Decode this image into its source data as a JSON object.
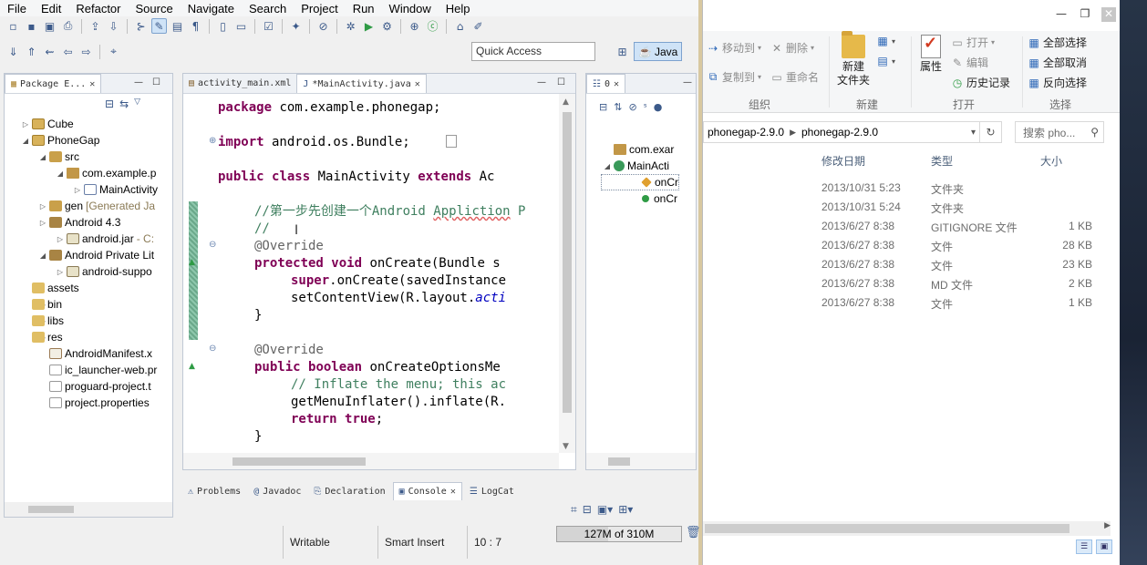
{
  "eclipse": {
    "menu": [
      "File",
      "Edit",
      "Refactor",
      "Source",
      "Navigate",
      "Search",
      "Project",
      "Run",
      "Window",
      "Help"
    ],
    "quick_access": "Quick Access",
    "perspective": "Java",
    "package_explorer": {
      "tab": "Package E...",
      "tree": [
        {
          "label": "Cube",
          "level": 0,
          "twisty": "▷",
          "icon": "proj"
        },
        {
          "label": "PhoneGap",
          "level": 0,
          "twisty": "◢",
          "icon": "proj"
        },
        {
          "label": "src",
          "level": 1,
          "twisty": "◢",
          "icon": "pkgf"
        },
        {
          "label": "com.example.p",
          "level": 2,
          "twisty": "◢",
          "icon": "pkg"
        },
        {
          "label": "MainActivity",
          "level": 3,
          "twisty": "▷",
          "icon": "java"
        },
        {
          "label": "gen",
          "level": 1,
          "twisty": "▷",
          "icon": "pkgf",
          "extra": "[Generated Ja"
        },
        {
          "label": "Android 4.3",
          "level": 1,
          "twisty": "▷",
          "icon": "lib"
        },
        {
          "label": "android.jar",
          "level": 2,
          "twisty": "▷",
          "icon": "jar",
          "extra": "- C:"
        },
        {
          "label": "Android Private Lit",
          "level": 1,
          "twisty": "◢",
          "icon": "lib"
        },
        {
          "label": "android-suppo",
          "level": 2,
          "twisty": "▷",
          "icon": "jar"
        },
        {
          "label": "assets",
          "level": 1,
          "twisty": "",
          "icon": "fold"
        },
        {
          "label": "bin",
          "level": 1,
          "twisty": "▷",
          "icon": "fold"
        },
        {
          "label": "libs",
          "level": 1,
          "twisty": "▷",
          "icon": "fold"
        },
        {
          "label": "res",
          "level": 1,
          "twisty": "▷",
          "icon": "fold"
        },
        {
          "label": "AndroidManifest.x",
          "level": 1,
          "twisty": "",
          "icon": "xml"
        },
        {
          "label": "ic_launcher-web.pr",
          "level": 1,
          "twisty": "",
          "icon": "file"
        },
        {
          "label": "proguard-project.t",
          "level": 1,
          "twisty": "",
          "icon": "file"
        },
        {
          "label": "project.properties",
          "level": 1,
          "twisty": "",
          "icon": "file"
        }
      ]
    },
    "editor": {
      "tabs": [
        {
          "label": "activity_main.xml",
          "active": false
        },
        {
          "label": "*MainActivity.java",
          "active": true
        }
      ],
      "lines": [
        {
          "y": 1,
          "indent": 1,
          "parts": [
            [
              "kw",
              "package"
            ],
            [
              "",
              " com.example.phonegap;"
            ]
          ]
        },
        {
          "y": 3,
          "indent": 1,
          "parts": [
            [
              "kw",
              "import"
            ],
            [
              "",
              " android.os.Bundle;"
            ]
          ]
        },
        {
          "y": 5,
          "indent": 1,
          "parts": [
            [
              "kw",
              "public"
            ],
            [
              "",
              " "
            ],
            [
              "kw",
              "class"
            ],
            [
              "",
              " MainActivity "
            ],
            [
              "kw",
              "extends"
            ],
            [
              "",
              " Ac"
            ]
          ]
        },
        {
          "y": 7,
          "indent": 2,
          "parts": [
            [
              "cm",
              "//第一步先创建一个Android "
            ],
            [
              "cm sq",
              "Appliction"
            ],
            [
              "cm",
              " P"
            ]
          ]
        },
        {
          "y": 8,
          "indent": 2,
          "parts": [
            [
              "cm",
              "//"
            ]
          ]
        },
        {
          "y": 9,
          "indent": 2,
          "parts": [
            [
              "an",
              "@Override"
            ]
          ]
        },
        {
          "y": 10,
          "indent": 2,
          "parts": [
            [
              "kw",
              "protected"
            ],
            [
              "",
              " "
            ],
            [
              "kw",
              "void"
            ],
            [
              "",
              " onCreate(Bundle s"
            ]
          ]
        },
        {
          "y": 11,
          "indent": 3,
          "parts": [
            [
              "kw",
              "super"
            ],
            [
              "",
              ".onCreate(savedInstance"
            ]
          ]
        },
        {
          "y": 12,
          "indent": 3,
          "parts": [
            [
              "",
              "setContentView(R.layout."
            ],
            [
              "it",
              "acti"
            ]
          ]
        },
        {
          "y": 13,
          "indent": 2,
          "parts": [
            [
              "",
              "}"
            ]
          ]
        },
        {
          "y": 15,
          "indent": 2,
          "parts": [
            [
              "an",
              "@Override"
            ]
          ]
        },
        {
          "y": 16,
          "indent": 2,
          "parts": [
            [
              "kw",
              "public"
            ],
            [
              "",
              " "
            ],
            [
              "kw",
              "boolean"
            ],
            [
              "",
              " onCreateOptionsMe"
            ]
          ]
        },
        {
          "y": 17,
          "indent": 3,
          "parts": [
            [
              "cm",
              "// Inflate the menu; this ac"
            ]
          ]
        },
        {
          "y": 18,
          "indent": 3,
          "parts": [
            [
              "",
              "getMenuInflater().inflate(R."
            ]
          ]
        },
        {
          "y": 19,
          "indent": 3,
          "parts": [
            [
              "kw",
              "return"
            ],
            [
              "",
              " "
            ],
            [
              "kw",
              "true"
            ],
            [
              "",
              ";"
            ]
          ]
        },
        {
          "y": 20,
          "indent": 2,
          "parts": [
            [
              "",
              "}"
            ]
          ]
        }
      ]
    },
    "outline": {
      "tab": "0",
      "items": [
        {
          "label": "com.exar",
          "icon": "imp",
          "twisty": ""
        },
        {
          "label": "MainActi",
          "icon": "cls",
          "twisty": "◢"
        },
        {
          "label": "onCr",
          "icon": "mth",
          "twisty": "",
          "sub": true,
          "selected": true
        },
        {
          "label": "onCr",
          "icon": "mth2",
          "twisty": "",
          "sub": true
        }
      ]
    },
    "bottom_tabs": [
      {
        "label": "Problems",
        "active": false
      },
      {
        "label": "Javadoc",
        "active": false
      },
      {
        "label": "Declaration",
        "active": false
      },
      {
        "label": "Console",
        "active": true
      },
      {
        "label": "LogCat",
        "active": false
      }
    ],
    "status": {
      "writable": "Writable",
      "insert_mode": "Smart Insert",
      "position": "10 : 7",
      "heap": "127M of 310M",
      "heap_used_fraction": 0.41
    }
  },
  "explorer": {
    "ribbon": {
      "move_to": "移动到",
      "copy_to": "复制到",
      "delete": "删除",
      "rename": "重命名",
      "new_folder": "新建\n文件夹",
      "properties": "属性",
      "open": "打开",
      "edit": "编辑",
      "history": "历史记录",
      "select_all": "全部选择",
      "select_none": "全部取消",
      "invert_selection": "反向选择",
      "groups": [
        "组织",
        "新建",
        "打开",
        "选择"
      ]
    },
    "address": [
      "phonegap-2.9.0",
      "phonegap-2.9.0"
    ],
    "search_placeholder": "搜索 pho...",
    "columns": [
      "修改日期",
      "类型",
      "大小"
    ],
    "files": [
      {
        "date": "2013/10/31 5:23",
        "type": "文件夹",
        "size": ""
      },
      {
        "date": "2013/10/31 5:24",
        "type": "文件夹",
        "size": ""
      },
      {
        "date": "2013/6/27 8:38",
        "type": "GITIGNORE 文件",
        "size": "1 KB"
      },
      {
        "date": "2013/6/27 8:38",
        "type": "文件",
        "size": "28 KB"
      },
      {
        "date": "2013/6/27 8:38",
        "type": "文件",
        "size": "23 KB"
      },
      {
        "date": "2013/6/27 8:38",
        "type": "MD 文件",
        "size": "2 KB"
      },
      {
        "date": "2013/6/27 8:38",
        "type": "文件",
        "size": "1 KB"
      }
    ]
  }
}
